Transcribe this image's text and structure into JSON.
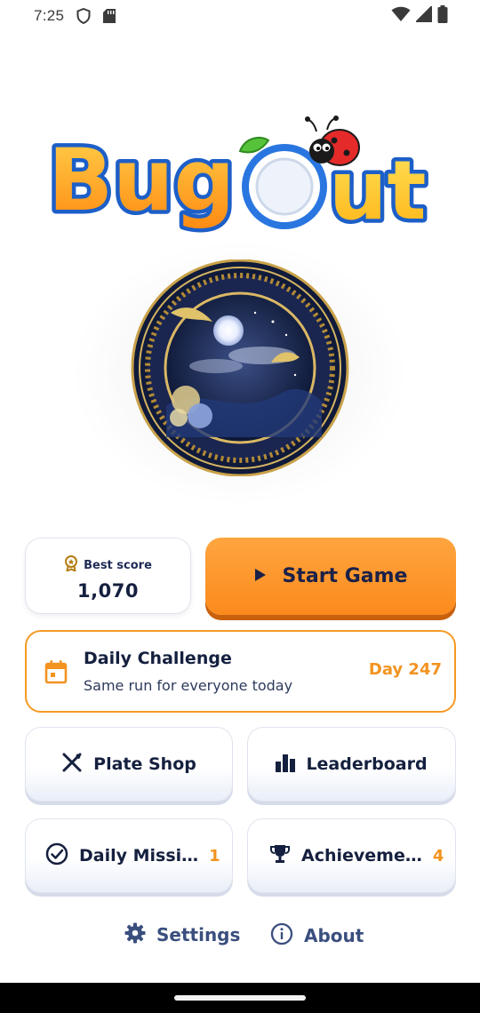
{
  "status_bar": {
    "time": "7:25",
    "left_icons": [
      "shield-icon",
      "sd-card-icon"
    ],
    "right_icons": [
      "wifi-icon",
      "signal-icon",
      "battery-icon"
    ]
  },
  "logo": {
    "text": "BugOut"
  },
  "best_score": {
    "label": "Best score",
    "value": "1,070",
    "icon": "award-icon"
  },
  "start_button": {
    "label": "Start Game",
    "icon": "play-icon"
  },
  "daily_challenge": {
    "title": "Daily Challenge",
    "subtitle": "Same run for everyone today",
    "day": "Day 247",
    "icon": "calendar-icon"
  },
  "menu": {
    "plate_shop": {
      "label": "Plate Shop",
      "icon": "utensils-icon"
    },
    "leaderboard": {
      "label": "Leaderboard",
      "icon": "bar-chart-icon"
    },
    "daily_missions": {
      "label": "Daily Missi…",
      "count": "1",
      "icon": "check-circle-icon"
    },
    "achievements": {
      "label": "Achieveme…",
      "count": "4",
      "icon": "trophy-icon"
    }
  },
  "footer": {
    "settings": {
      "label": "Settings",
      "icon": "gear-icon"
    },
    "about": {
      "label": "About",
      "icon": "info-icon"
    }
  },
  "colors": {
    "accent_orange": "#fb8a1d",
    "navy_text": "#15203f",
    "link_blue": "#3a4f7e"
  }
}
